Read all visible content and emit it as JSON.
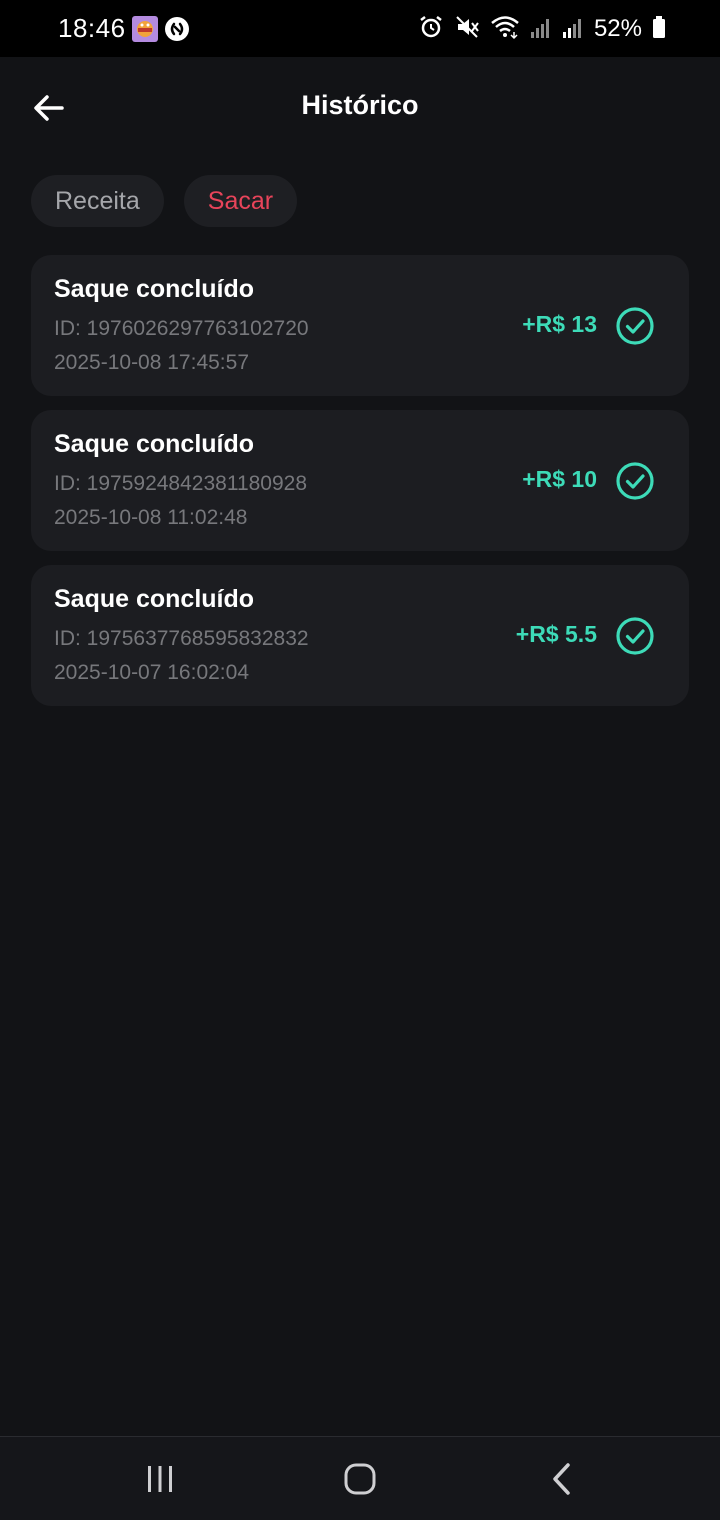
{
  "status_bar": {
    "time": "18:46",
    "battery": "52%",
    "icons": [
      "game-app-icon",
      "shazam-icon",
      "alarm-icon",
      "mute-icon",
      "wifi-icon",
      "signal-icon",
      "signal-icon",
      "battery-icon"
    ]
  },
  "header": {
    "title": "Histórico",
    "back_icon": "arrow-left-icon"
  },
  "tabs": [
    {
      "label": "Receita",
      "active": false
    },
    {
      "label": "Sacar",
      "active": true
    }
  ],
  "colors": {
    "background": "#121316",
    "card": "#1c1d21",
    "active_tab": "#e8445a",
    "amount": "#3ddbb8",
    "muted_text": "#77787c"
  },
  "transactions": [
    {
      "title": "Saque concluído",
      "id": "ID: 1976026297763102720",
      "date": "2025-10-08 17:45:57",
      "amount": "+R$ 13",
      "status_icon": "check-circle-icon"
    },
    {
      "title": "Saque concluído",
      "id": "ID: 1975924842381180928",
      "date": "2025-10-08 11:02:48",
      "amount": "+R$ 10",
      "status_icon": "check-circle-icon"
    },
    {
      "title": "Saque concluído",
      "id": "ID: 1975637768595832832",
      "date": "2025-10-07 16:02:04",
      "amount": "+R$ 5.5",
      "status_icon": "check-circle-icon"
    }
  ],
  "nav_bar": {
    "icons": [
      "recent-apps-icon",
      "home-icon",
      "back-icon"
    ]
  }
}
